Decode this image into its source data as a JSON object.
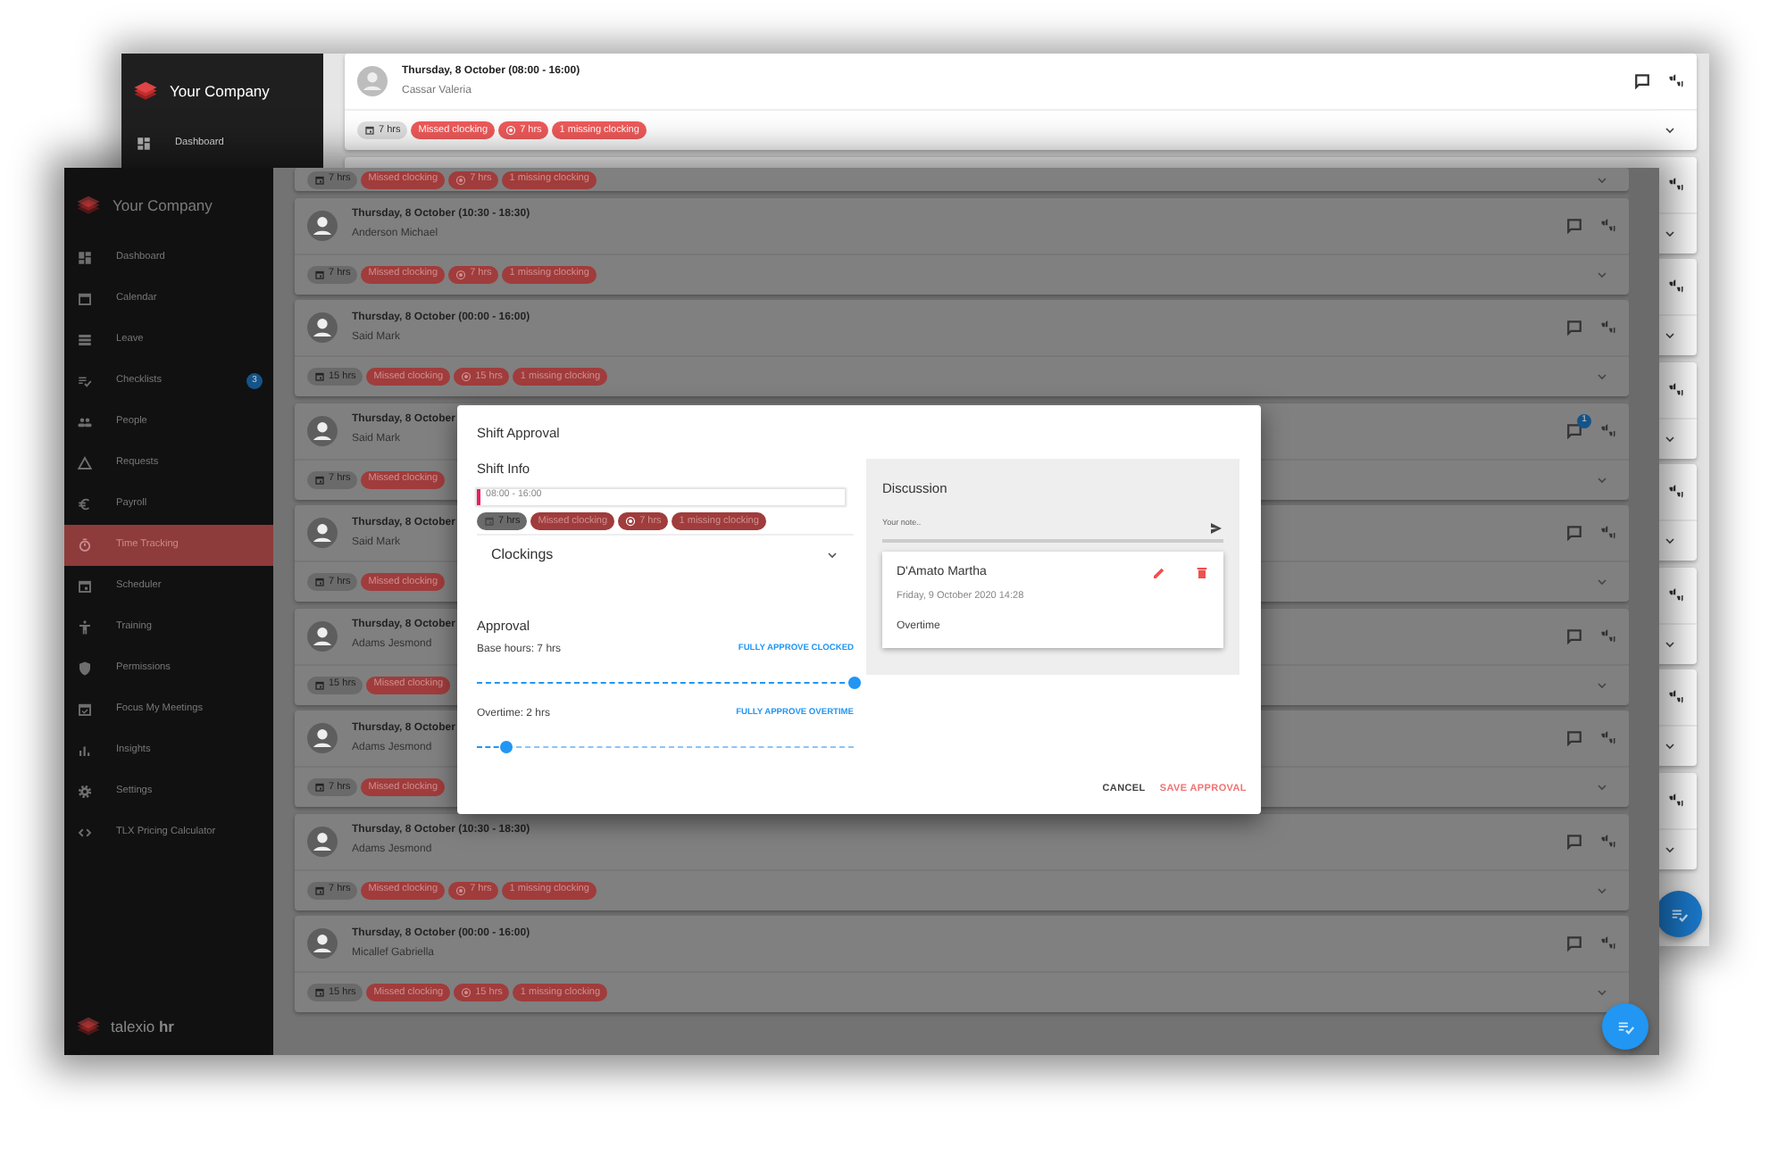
{
  "back_window": {
    "brand": "Your Company",
    "nav": [
      {
        "label": "Dashboard",
        "selected": false
      }
    ],
    "cards": [
      {
        "date": "Thursday, 8 October (08:00 - 16:00)",
        "name": "Cassar Valeria",
        "hours": "7 hrs",
        "status": "Missed clocking",
        "missed_hours": "7 hrs",
        "missing": "1 missing clocking"
      }
    ]
  },
  "front_window": {
    "brand": "Your Company",
    "nav": [
      {
        "label": "Dashboard",
        "selected": false
      },
      {
        "label": "Calendar",
        "selected": false
      },
      {
        "label": "Leave",
        "selected": false
      },
      {
        "label": "Checklists",
        "selected": false,
        "badge": "3"
      },
      {
        "label": "People",
        "selected": false
      },
      {
        "label": "Requests",
        "selected": false
      },
      {
        "label": "Payroll",
        "selected": false
      },
      {
        "label": "Time Tracking",
        "selected": true
      },
      {
        "label": "Scheduler",
        "selected": false
      },
      {
        "label": "Training",
        "selected": false
      },
      {
        "label": "Permissions",
        "selected": false
      },
      {
        "label": "Focus My Meetings",
        "selected": false
      },
      {
        "label": "Insights",
        "selected": false
      },
      {
        "label": "Settings",
        "selected": false
      },
      {
        "label": "TLX Pricing Calculator",
        "selected": false
      }
    ],
    "footer_brand": "talexio **hr**",
    "cards": [
      {
        "hours": "7 hrs",
        "status": "Missed clocking",
        "missed_hours": "7 hrs",
        "missing": "1 missing clocking"
      },
      {
        "date": "Thursday, 8 October (10:30 - 18:30)",
        "name": "Anderson Michael",
        "hours": "7 hrs",
        "status": "Missed clocking",
        "missed_hours": "7 hrs",
        "missing": "1 missing clocking"
      },
      {
        "date": "Thursday, 8 October (00:00 - 16:00)",
        "name": "Said Mark",
        "hours": "15 hrs",
        "status": "Missed clocking",
        "missed_hours": "15 hrs",
        "missing": "1 missing clocking"
      },
      {
        "date": "Thursday, 8 October",
        "name": "Said Mark",
        "hours": "7 hrs",
        "status": "Missed clocking",
        "comment_badge": "1"
      },
      {
        "date": "Thursday, 8 October",
        "name": "Said Mark",
        "hours": "7 hrs",
        "status": "Missed clocking"
      },
      {
        "date": "Thursday, 8 October",
        "name": "Adams Jesmond",
        "hours": "15 hrs",
        "status": "Missed clocking"
      },
      {
        "date": "Thursday, 8 October",
        "name": "Adams Jesmond",
        "hours": "7 hrs",
        "status": "Missed clocking"
      },
      {
        "date": "Thursday, 8 October (10:30 - 18:30)",
        "name": "Adams Jesmond",
        "hours": "7 hrs",
        "status": "Missed clocking",
        "missed_hours": "7 hrs",
        "missing": "1 missing clocking"
      },
      {
        "date": "Thursday, 8 October (00:00 - 16:00)",
        "name": "Micallef Gabriella",
        "hours": "15 hrs",
        "status": "Missed clocking",
        "missed_hours": "15 hrs",
        "missing": "1 missing clocking"
      }
    ]
  },
  "dialog": {
    "title": "Shift Approval",
    "shift_info": {
      "heading": "Shift Info",
      "time": "08:00 - 16:00",
      "hours": "7 hrs",
      "status": "Missed clocking",
      "missed_hours": "7 hrs",
      "missing": "1 missing clocking"
    },
    "clockings": {
      "label": "Clockings",
      "expanded": false
    },
    "approval": {
      "heading": "Approval",
      "sliders": [
        {
          "label": "Base hours: 7 hrs",
          "action": "FULLY APPROVE CLOCKED",
          "level": 1
        },
        {
          "label": "Overtime: 2 hrs",
          "action": "FULLY APPROVE OVERTIME",
          "level": 0.08
        }
      ]
    },
    "discussion": {
      "heading": "Discussion",
      "placeholder": "Your note..",
      "comments": [
        {
          "author": "D'Amato Martha",
          "time": "Friday, 9 October 2020 14:28",
          "text": "Overtime"
        }
      ]
    },
    "buttons": [
      {
        "label": "CANCEL",
        "kind": "text"
      },
      {
        "label": "SAVE APPROVAL",
        "kind": "primary"
      }
    ]
  }
}
